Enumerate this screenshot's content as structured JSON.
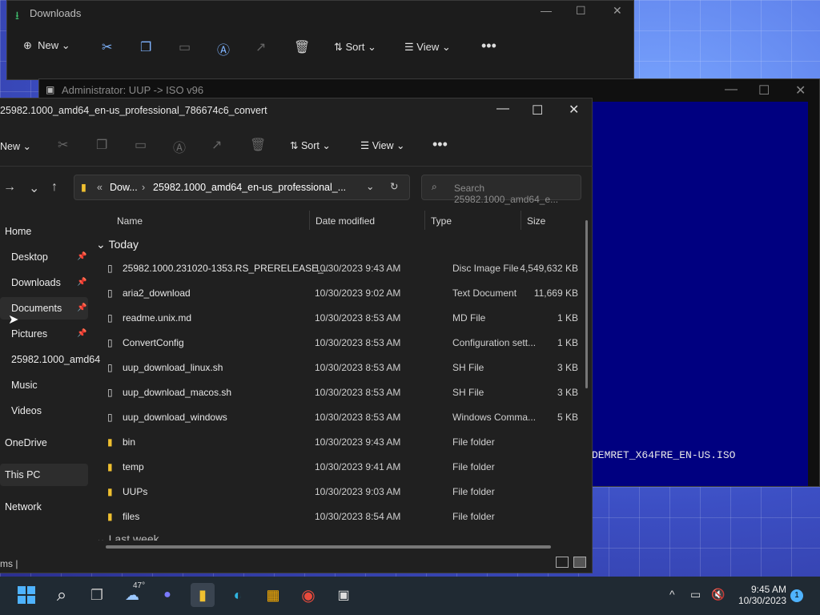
{
  "back_window": {
    "title": "Downloads",
    "toolbar": {
      "new": "New",
      "sort": "Sort",
      "view": "View"
    }
  },
  "terminal": {
    "title": "Administrator:  UUP -> ISO v96",
    "output_line": "DEMRET_X64FRE_EN-US.ISO"
  },
  "explorer": {
    "title": "25982.1000_amd64_en-us_professional_786674c6_convert",
    "toolbar": {
      "new": "New",
      "sort": "Sort",
      "view": "View"
    },
    "address": {
      "prefix": "Dow...",
      "current": "25982.1000_amd64_en-us_professional_..."
    },
    "search_placeholder": "Search 25982.1000_amd64_e...",
    "columns": {
      "name": "Name",
      "date": "Date modified",
      "type": "Type",
      "size": "Size"
    },
    "group_today": "Today",
    "group_last_week": "Last week",
    "files": [
      {
        "name": "25982.1000.231020-1353.RS_PRERELEASE_...",
        "date": "10/30/2023 9:43 AM",
        "type": "Disc Image File",
        "size": "4,549,632 KB"
      },
      {
        "name": "aria2_download",
        "date": "10/30/2023 9:02 AM",
        "type": "Text Document",
        "size": "11,669 KB"
      },
      {
        "name": "readme.unix.md",
        "date": "10/30/2023 8:53 AM",
        "type": "MD File",
        "size": "1 KB"
      },
      {
        "name": "ConvertConfig",
        "date": "10/30/2023 8:53 AM",
        "type": "Configuration sett...",
        "size": "1 KB"
      },
      {
        "name": "uup_download_linux.sh",
        "date": "10/30/2023 8:53 AM",
        "type": "SH File",
        "size": "3 KB"
      },
      {
        "name": "uup_download_macos.sh",
        "date": "10/30/2023 8:53 AM",
        "type": "SH File",
        "size": "3 KB"
      },
      {
        "name": "uup_download_windows",
        "date": "10/30/2023 8:53 AM",
        "type": "Windows Comma...",
        "size": "5 KB"
      },
      {
        "name": "bin",
        "date": "10/30/2023 9:43 AM",
        "type": "File folder",
        "size": ""
      },
      {
        "name": "temp",
        "date": "10/30/2023 9:41 AM",
        "type": "File folder",
        "size": ""
      },
      {
        "name": "UUPs",
        "date": "10/30/2023 9:03 AM",
        "type": "File folder",
        "size": ""
      },
      {
        "name": "files",
        "date": "10/30/2023 8:54 AM",
        "type": "File folder",
        "size": ""
      }
    ],
    "sidebar": [
      {
        "label": "Home"
      },
      {
        "label": "Desktop"
      },
      {
        "label": "Downloads"
      },
      {
        "label": "Documents"
      },
      {
        "label": "Pictures"
      },
      {
        "label": "25982.1000_amd64"
      },
      {
        "label": "Music"
      },
      {
        "label": "Videos"
      },
      {
        "label": "OneDrive"
      },
      {
        "label": "This PC"
      },
      {
        "label": "Network"
      }
    ],
    "status": "ms  |"
  },
  "taskbar": {
    "weather": "47°",
    "time": "9:45 AM",
    "date": "10/30/2023",
    "notifications": "1"
  }
}
